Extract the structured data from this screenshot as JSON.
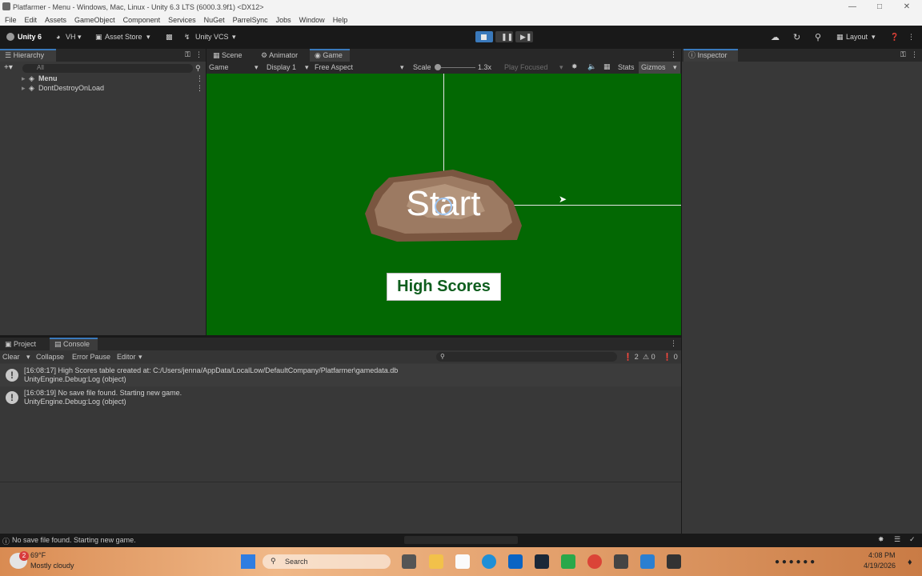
{
  "window": {
    "title": "Platfarmer - Menu - Windows, Mac, Linux - Unity 6.3 LTS (6000.3.9f1) <DX12>"
  },
  "menu": [
    "File",
    "Edit",
    "Assets",
    "GameObject",
    "Component",
    "Services",
    "NuGet",
    "ParrelSync",
    "Jobs",
    "Window",
    "Help"
  ],
  "toolbar": {
    "account": "Unity 6",
    "user": "VH",
    "asset_store": "Asset Store",
    "vcs": "Unity VCS",
    "layout": "Layout"
  },
  "hierarchy": {
    "tab": "Hierarchy",
    "search_placeholder": "All",
    "items": [
      "Menu",
      "DontDestroyOnLoad"
    ]
  },
  "center_tabs": [
    "Scene",
    "Animator",
    "Game"
  ],
  "game_toolbar": {
    "view": "Game",
    "display": "Display 1",
    "aspect": "Free Aspect",
    "scale_label": "Scale",
    "scale_value": "1.3x",
    "play_focused": "Play Focused",
    "stats": "Stats",
    "gizmos": "Gizmos"
  },
  "game": {
    "start_label": "Start",
    "high_scores_label": "High Scores"
  },
  "inspector": {
    "tab": "Inspector"
  },
  "bottom_tabs": [
    "Project",
    "Console"
  ],
  "console_toolbar": {
    "clear": "Clear",
    "collapse": "Collapse",
    "error_pause": "Error Pause",
    "editor": "Editor",
    "count_log": "2",
    "count_warn": "0",
    "count_err": "0"
  },
  "console_logs": [
    {
      "line1": "[16:08:17] High Scores table created at: C:/Users/jenna/AppData/LocalLow/DefaultCompany/Platfarmer\\gamedata.db",
      "line2": "UnityEngine.Debug:Log (object)"
    },
    {
      "line1": "[16:08:19] No save file found. Starting new game.",
      "line2": "UnityEngine.Debug:Log (object)"
    }
  ],
  "status": {
    "message": "No save file found. Starting new game."
  },
  "taskbar": {
    "temp": "69°F",
    "weather": "Mostly cloudy",
    "search": "Search",
    "time": "4:08 PM",
    "date": "4/19/2026",
    "badge": "2"
  },
  "colors": {
    "game_bg": "#036803",
    "accent": "#3a79bb",
    "hs_text": "#0f5e1e"
  }
}
